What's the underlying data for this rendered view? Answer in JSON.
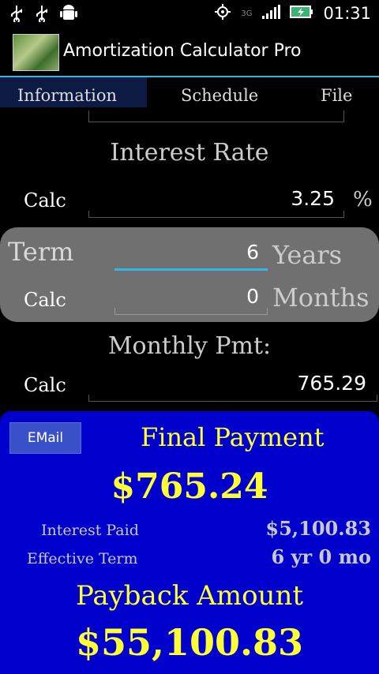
{
  "status": {
    "time": "01:31",
    "network": "3G"
  },
  "app": {
    "title": "Amortization Calculator Pro"
  },
  "tabs": [
    {
      "label": "Information"
    },
    {
      "label": "Schedule"
    },
    {
      "label": "File"
    }
  ],
  "interest": {
    "title": "Interest Rate",
    "calc_label": "Calc",
    "value": "3.25",
    "unit": "%"
  },
  "term": {
    "label": "Term",
    "years_value": "6",
    "years_unit": "Years",
    "calc_label": "Calc",
    "months_value": "0",
    "months_unit": "Months"
  },
  "monthly": {
    "title": "Monthly Pmt:",
    "calc_label": "Calc",
    "value": "765.29"
  },
  "results": {
    "email_label": "EMail",
    "final_title": "Final Payment",
    "final_value": "$765.24",
    "interest_label": "Interest Paid",
    "interest_value": "$5,100.83",
    "term_label": "Effective Term",
    "term_value": "6 yr 0 mo",
    "payback_title": "Payback Amount",
    "payback_value": "$55,100.83"
  },
  "colors": {
    "accent": "#33b5e5",
    "results_bg": "#0000cc",
    "highlight": "#ffff33"
  }
}
